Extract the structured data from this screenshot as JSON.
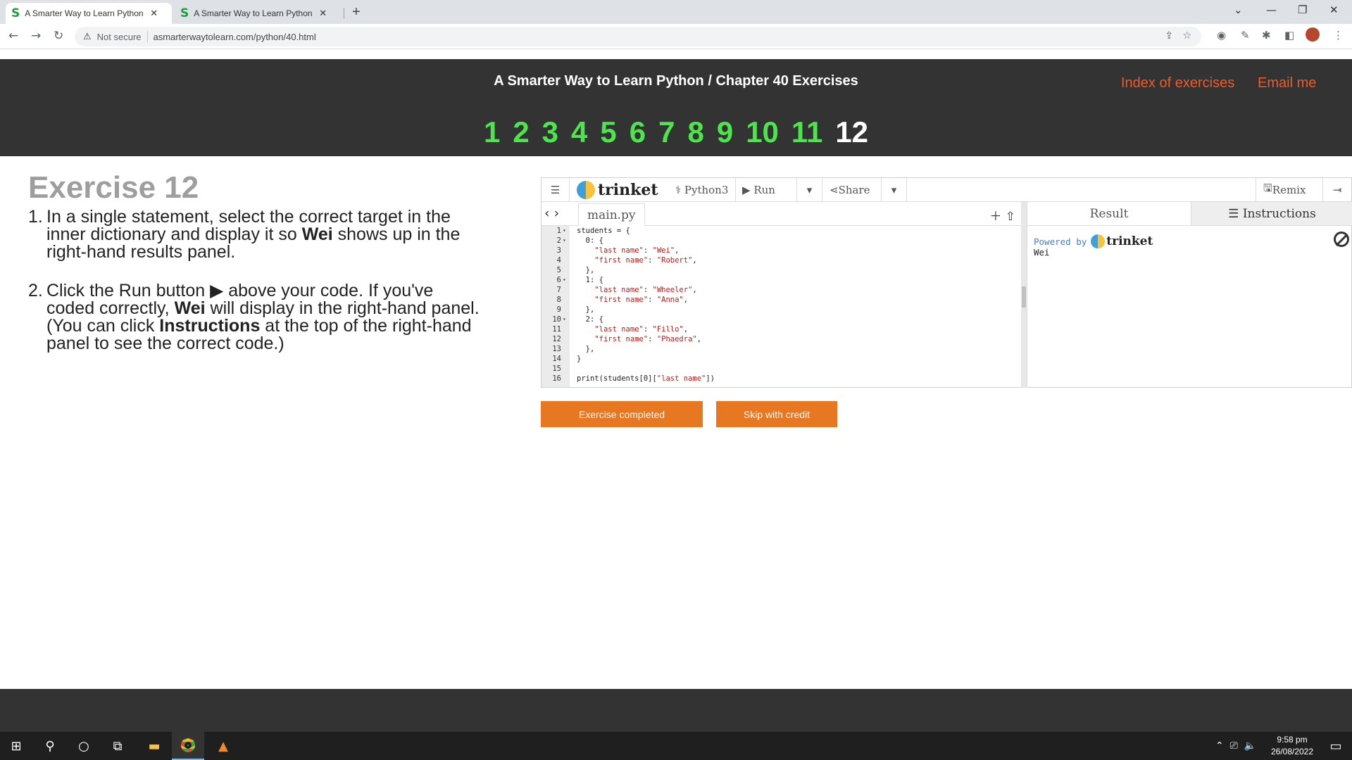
{
  "browser": {
    "tabs": [
      {
        "favicon": "S",
        "title": "A Smarter Way to Learn Python -"
      },
      {
        "favicon": "S",
        "title": "A Smarter Way to Learn Python -"
      }
    ],
    "new_tab": "+",
    "not_secure": "Not secure",
    "url": "asmarterwaytolearn.com/python/40.html"
  },
  "header": {
    "title": "A Smarter Way to Learn Python / Chapter 40 Exercises",
    "index_link": "Index of exercises",
    "email_link": "Email me",
    "pages": [
      "1",
      "2",
      "3",
      "4",
      "5",
      "6",
      "7",
      "8",
      "9",
      "10",
      "11",
      "12"
    ],
    "current_page": "12"
  },
  "exercise": {
    "title": "Exercise 12",
    "items": [
      {
        "num": "1.",
        "pre": "In a single statement, select the correct target in the inner dictionary and display it so ",
        "bold": "Wei",
        "post": " shows up in the right-hand results panel."
      },
      {
        "num": "2.",
        "pre": "Click the Run button ▶ above your code. If you've coded correctly, ",
        "bold": "Wei",
        "mid": " will display in the right-hand panel. (You can click ",
        "bold2": "Instructions",
        "post": " at the top of the right-hand panel to see the correct code.)"
      }
    ]
  },
  "trinket": {
    "logo": "trinket",
    "language": "Python3",
    "run": "Run",
    "share": "Share",
    "remix": "Remix",
    "file_tab": "main.py",
    "result_tab": "Result",
    "instructions_tab": "Instructions",
    "powered_by": "Powered by",
    "output": "Wei",
    "code_lines": [
      "students = {",
      "  0: {",
      "    \"last name\": \"Wei\",",
      "    \"first name\": \"Robert\",",
      "  },",
      "  1: {",
      "    \"last name\": \"Wheeler\",",
      "    \"first name\": \"Anna\",",
      "  },",
      "  2: {",
      "    \"last name\": \"Fillo\",",
      "    \"first name\": \"Phaedra\",",
      "  },",
      "}",
      "",
      "print(students[0][\"last name\"])"
    ],
    "fold_lines": [
      1,
      2,
      6,
      10
    ]
  },
  "buttons": {
    "completed": "Exercise completed",
    "skip": "Skip with credit"
  },
  "taskbar": {
    "time": "9:58 pm",
    "date": "26/08/2022"
  }
}
